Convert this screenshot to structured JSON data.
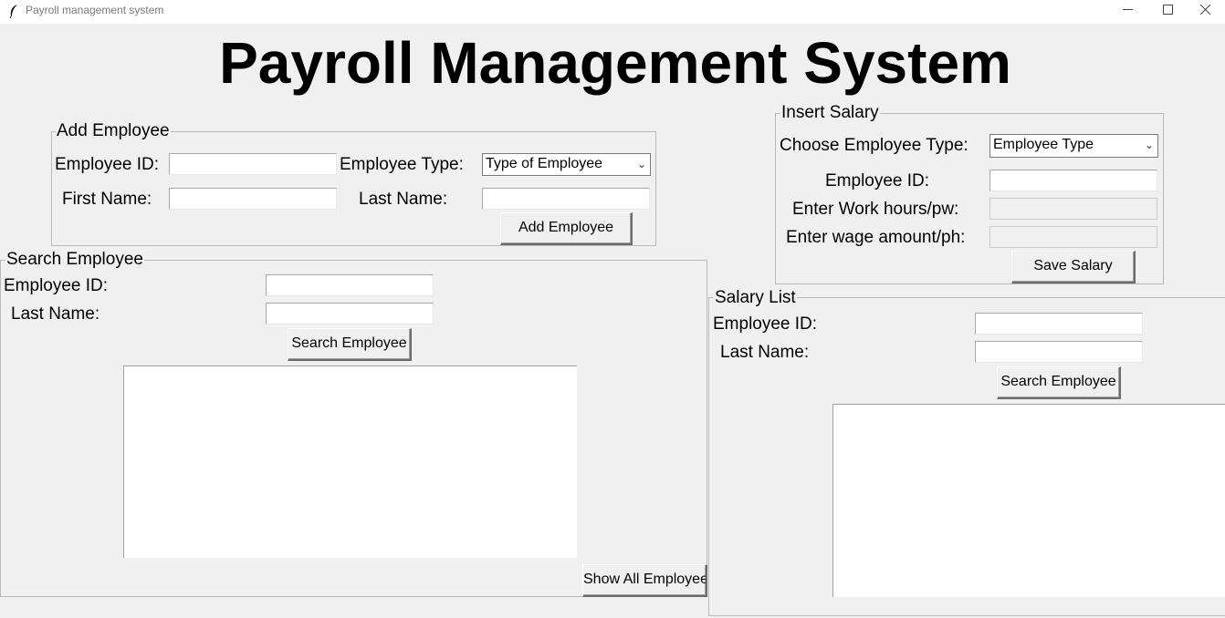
{
  "window": {
    "title": "Payroll management system"
  },
  "heading": "Payroll Management System",
  "add_employee": {
    "legend": "Add Employee",
    "employee_id_label": "Employee ID:",
    "employee_type_label": "Employee Type:",
    "employee_type_value": "Type of Employee",
    "first_name_label": "First Name:",
    "last_name_label": "Last Name:",
    "add_button": "Add Employee"
  },
  "insert_salary": {
    "legend": "Insert Salary",
    "choose_type_label": "Choose Employee Type:",
    "employee_type_value": "Employee Type",
    "employee_id_label": "Employee ID:",
    "work_hours_label": "Enter Work hours/pw:",
    "wage_label": "Enter wage amount/ph:",
    "save_button": "Save Salary"
  },
  "search_employee": {
    "legend": "Search Employee",
    "employee_id_label": "Employee ID:",
    "last_name_label": "Last Name:",
    "search_button": "Search Employee",
    "show_all_button": "Show All Employee"
  },
  "salary_list": {
    "legend": "Salary List",
    "employee_id_label": "Employee ID:",
    "last_name_label": "Last Name:",
    "search_button": "Search Employee"
  },
  "icons": {
    "app": "feather-icon",
    "minimize": "minimize-icon",
    "maximize": "maximize-icon",
    "close": "close-icon",
    "dropdown": "chevron-down-icon"
  }
}
